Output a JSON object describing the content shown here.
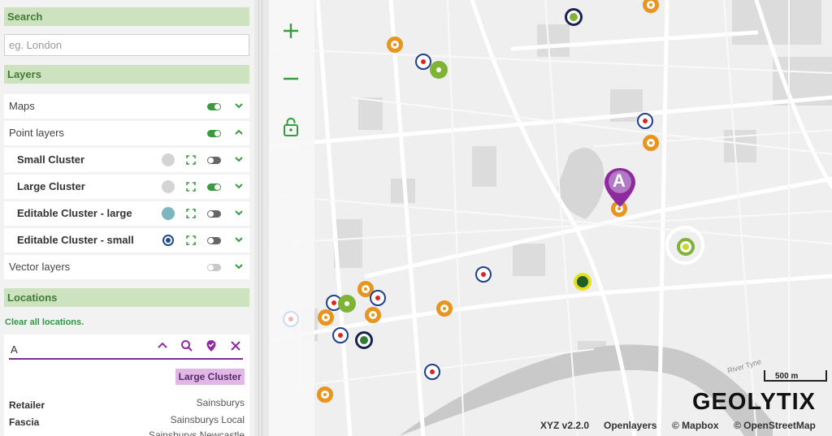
{
  "search": {
    "header": "Search",
    "placeholder": "eg. London",
    "value": ""
  },
  "layers": {
    "header": "Layers",
    "items": [
      {
        "label": "Maps",
        "toggle": "on",
        "expanded": false
      },
      {
        "label": "Point layers",
        "toggle": "on",
        "expanded": true
      },
      {
        "label": "Small Cluster",
        "toggle": "off",
        "expanded": false,
        "dot": "grey"
      },
      {
        "label": "Large Cluster",
        "toggle": "on",
        "expanded": false,
        "dot": "grey"
      },
      {
        "label": "Editable Cluster - large",
        "toggle": "off",
        "expanded": false,
        "dot": "teal"
      },
      {
        "label": "Editable Cluster - small",
        "toggle": "off",
        "expanded": false,
        "dot": "target"
      },
      {
        "label": "Vector layers",
        "toggle": "disabled",
        "expanded": false
      }
    ]
  },
  "locations": {
    "header": "Locations",
    "clear_label": "Clear all locations.",
    "input_value": "A",
    "badge": "Large Cluster",
    "fields": [
      {
        "key": "Retailer",
        "value": "Sainsburys"
      },
      {
        "key": "Fascia",
        "value": "Sainsburys Local"
      },
      {
        "key": "",
        "value": "Sainsburys Newcastle"
      }
    ]
  },
  "map": {
    "pin_label": "A",
    "river_label": "River Tyne",
    "scale_label": "500 m",
    "brand": "GEOLYTIX",
    "attribution": [
      "XYZ v2.2.0",
      "Openlayers",
      "© Mapbox",
      "© OpenStreetMap"
    ]
  },
  "colors": {
    "accent_green": "#3a9a3f",
    "header_green": "#cde3c0",
    "location_purple": "#8e2a9e",
    "marker_orange": "#e8951f",
    "marker_blue": "#1f3f8a"
  }
}
